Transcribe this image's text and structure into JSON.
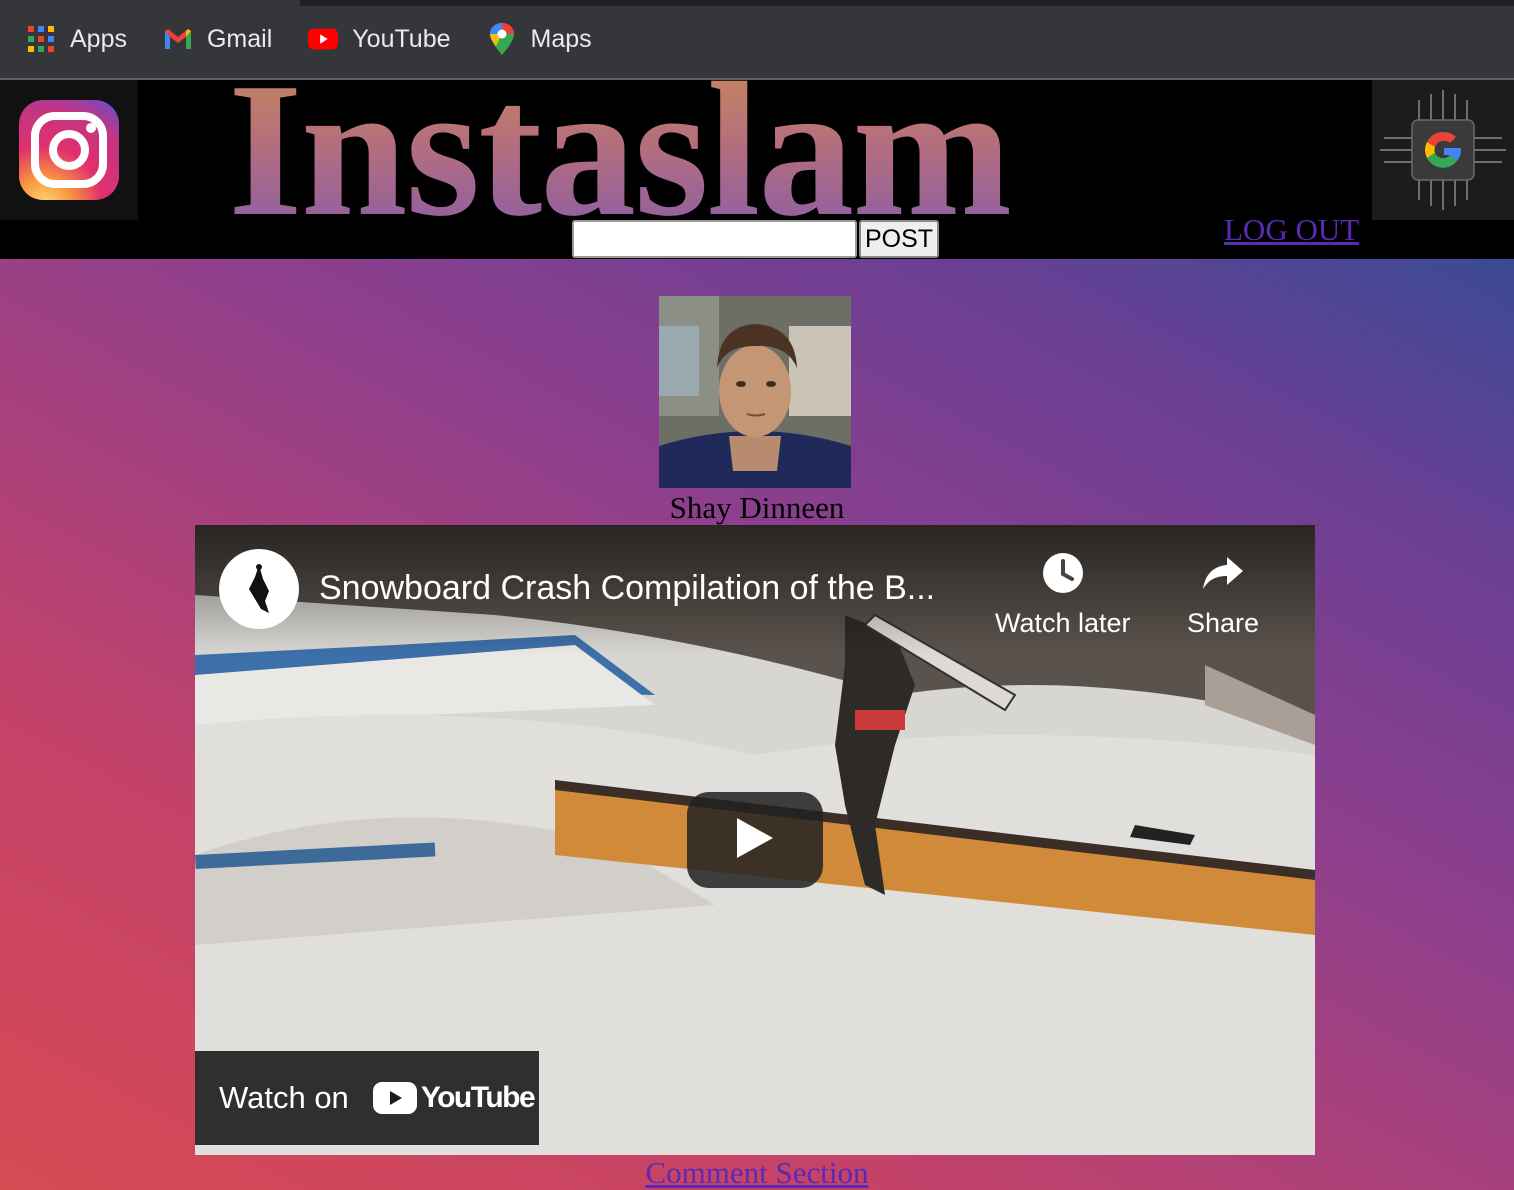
{
  "bookmarks": [
    {
      "label": "Apps",
      "icon": "apps-grid-icon"
    },
    {
      "label": "Gmail",
      "icon": "gmail-icon"
    },
    {
      "label": "YouTube",
      "icon": "youtube-icon"
    },
    {
      "label": "Maps",
      "icon": "maps-icon"
    }
  ],
  "header": {
    "brand": "Instaslam",
    "logout_label": "LOG OUT",
    "post_input_value": "",
    "post_button_label": "POST"
  },
  "profile": {
    "name": "Shay Dinneen"
  },
  "video": {
    "title": "Snowboard Crash Compilation of the B...",
    "watch_later_label": "Watch later",
    "share_label": "Share",
    "watch_on_label": "Watch on",
    "youtube_label": "YouTube"
  },
  "comment_link": "Comment Section",
  "colors": {
    "link": "#5a2ab5",
    "bookmark_bar": "#35363a",
    "header_bg": "#000000",
    "gradient_start": "#d64a52",
    "gradient_end": "#3b4a96"
  }
}
